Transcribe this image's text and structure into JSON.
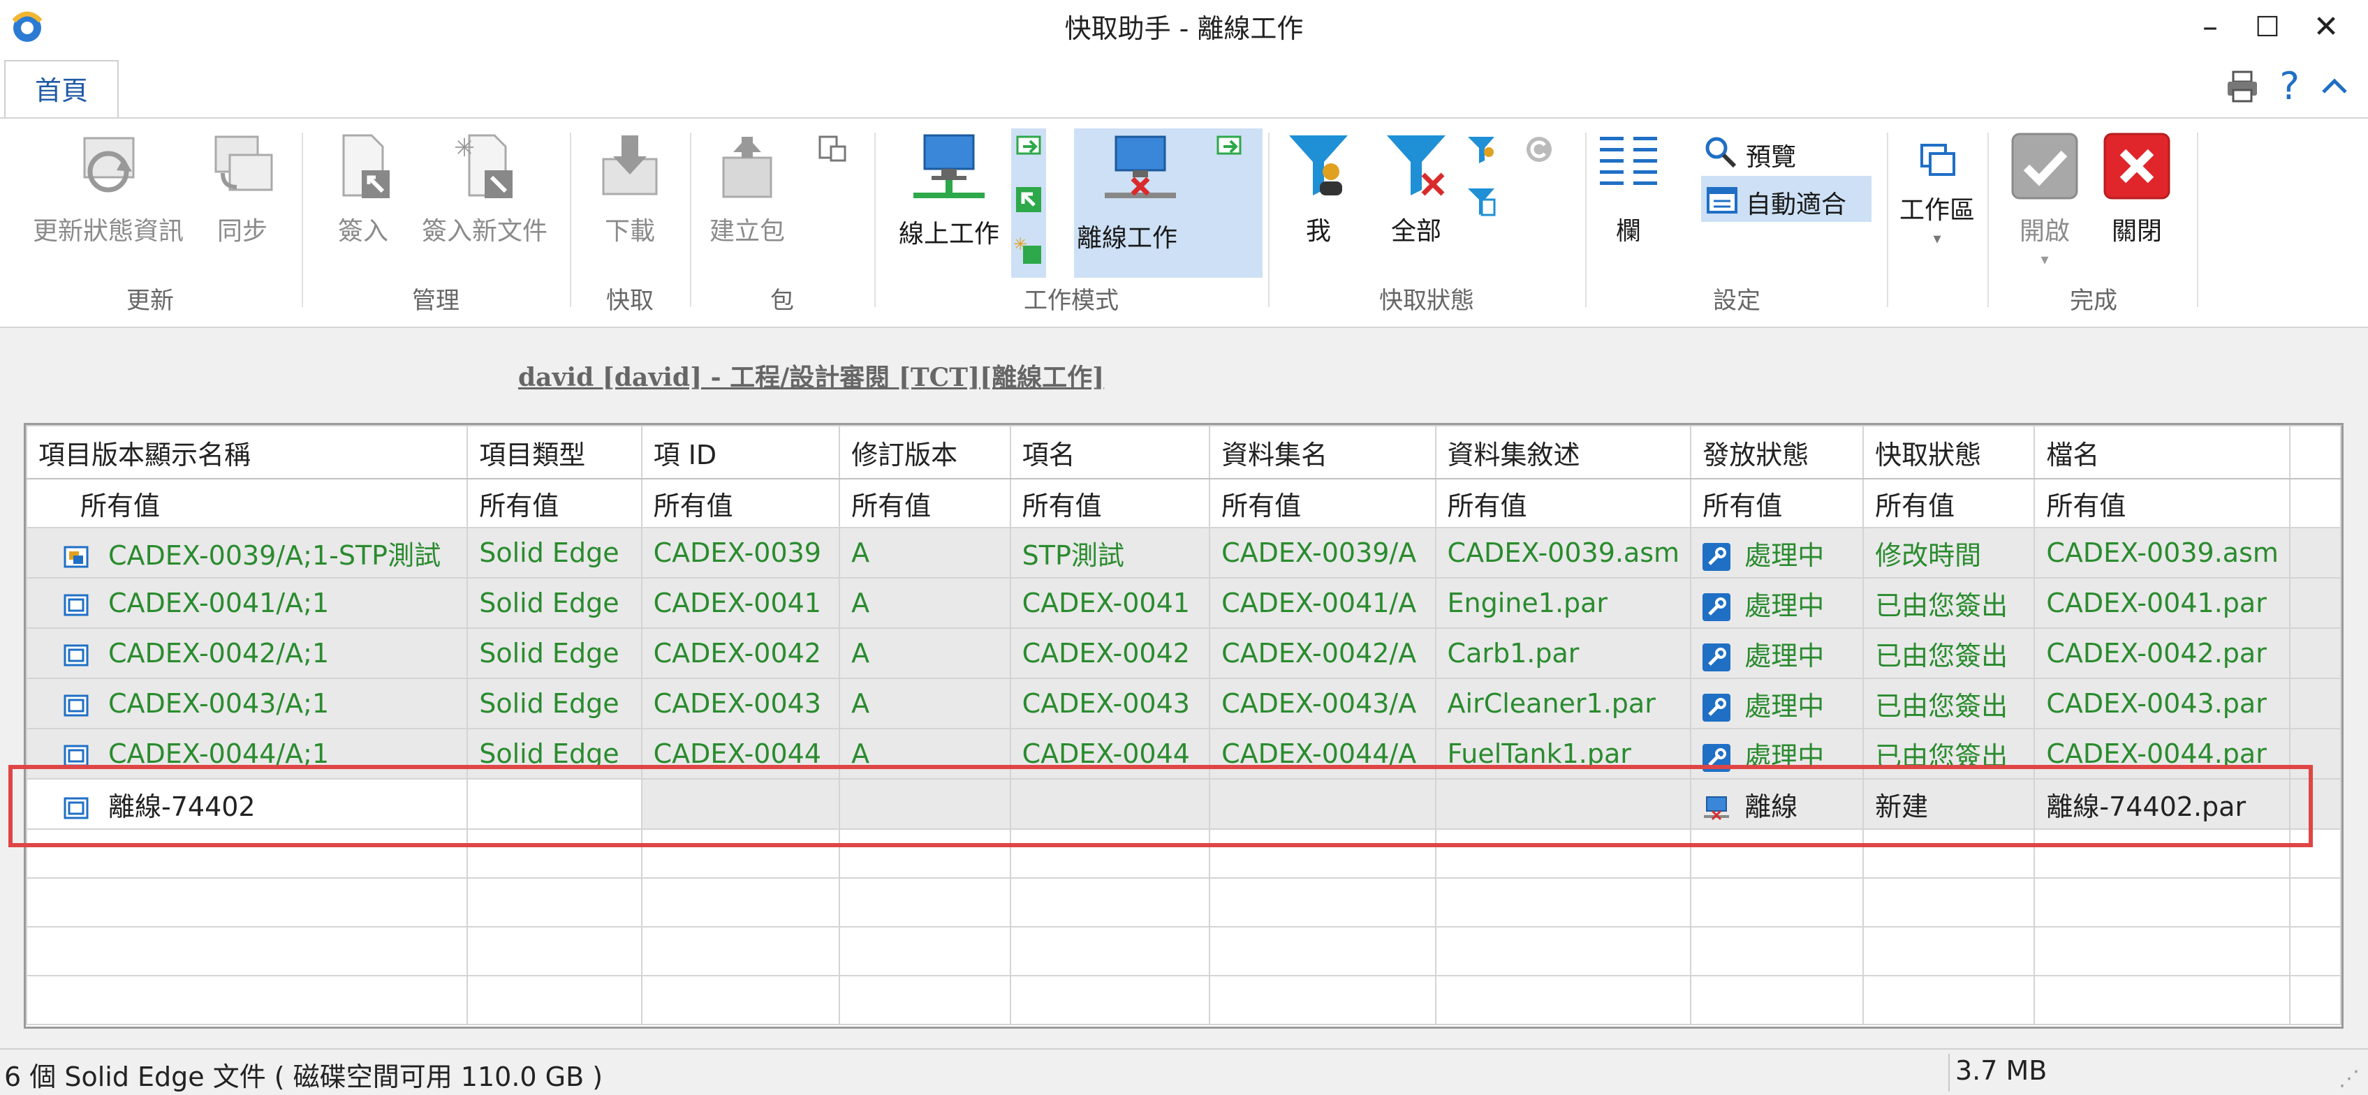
{
  "window": {
    "title": "快取助手 - 離線工作",
    "min_glyph": "–",
    "max_glyph": "☐",
    "close_glyph": "✕"
  },
  "tabs": {
    "home": "首頁"
  },
  "ribbon": {
    "groups": {
      "update": "更新",
      "manage": "管理",
      "cache": "快取",
      "package": "包",
      "workmode": "工作模式",
      "cachestatus": "快取狀態",
      "settings": "設定",
      "finish": "完成"
    },
    "buttons": {
      "update_status": "更新狀態資訊",
      "sync": "同步",
      "checkin": "簽入",
      "checkin_new": "簽入新文件",
      "download": "下載",
      "create_package": "建立包",
      "online": "線上工作",
      "offline": "離線工作",
      "me": "我",
      "all": "全部",
      "columns": "欄",
      "preview": "預覽",
      "auto_fit": "自動適合",
      "workspace": "工作區",
      "open": "開啟",
      "close": "關閉"
    }
  },
  "session": "david [david] - 工程/設計審閱 [TCT][離線工作]",
  "grid": {
    "columns": [
      "項目版本顯示名稱",
      "項目類型",
      "項 ID",
      "修訂版本",
      "項名",
      "資料集名",
      "資料集敘述",
      "發放狀態",
      "快取狀態",
      "檔名"
    ],
    "filter_label": "所有值",
    "rows": [
      {
        "name": "CADEX-0039/A;1-STP測試",
        "type": "Solid Edge",
        "id": "CADEX-0039",
        "rev": "A",
        "item": "STP測試",
        "dataset": "CADEX-0039/A",
        "desc": "CADEX-0039.asm",
        "release": "處理中",
        "cache": "修改時間",
        "file": "CADEX-0039.asm"
      },
      {
        "name": "CADEX-0041/A;1",
        "type": "Solid Edge",
        "id": "CADEX-0041",
        "rev": "A",
        "item": "CADEX-0041",
        "dataset": "CADEX-0041/A",
        "desc": "Engine1.par",
        "release": "處理中",
        "cache": "已由您簽出",
        "file": "CADEX-0041.par"
      },
      {
        "name": "CADEX-0042/A;1",
        "type": "Solid Edge",
        "id": "CADEX-0042",
        "rev": "A",
        "item": "CADEX-0042",
        "dataset": "CADEX-0042/A",
        "desc": "Carb1.par",
        "release": "處理中",
        "cache": "已由您簽出",
        "file": "CADEX-0042.par"
      },
      {
        "name": "CADEX-0043/A;1",
        "type": "Solid Edge",
        "id": "CADEX-0043",
        "rev": "A",
        "item": "CADEX-0043",
        "dataset": "CADEX-0043/A",
        "desc": "AirCleaner1.par",
        "release": "處理中",
        "cache": "已由您簽出",
        "file": "CADEX-0043.par"
      },
      {
        "name": "CADEX-0044/A;1",
        "type": "Solid Edge",
        "id": "CADEX-0044",
        "rev": "A",
        "item": "CADEX-0044",
        "dataset": "CADEX-0044/A",
        "desc": "FuelTank1.par",
        "release": "處理中",
        "cache": "已由您簽出",
        "file": "CADEX-0044.par"
      }
    ],
    "offline_row": {
      "name": "離線-74402",
      "release": "離線",
      "cache": "新建",
      "file": "離線-74402.par"
    }
  },
  "status": {
    "left": "6 個 Solid Edge 文件 ( 磁碟空間可用 110.0 GB )",
    "right": "3.7 MB"
  },
  "colors": {
    "accent": "#1f6fc5",
    "green_text": "#2a8b2e",
    "highlight": "#e04545"
  }
}
